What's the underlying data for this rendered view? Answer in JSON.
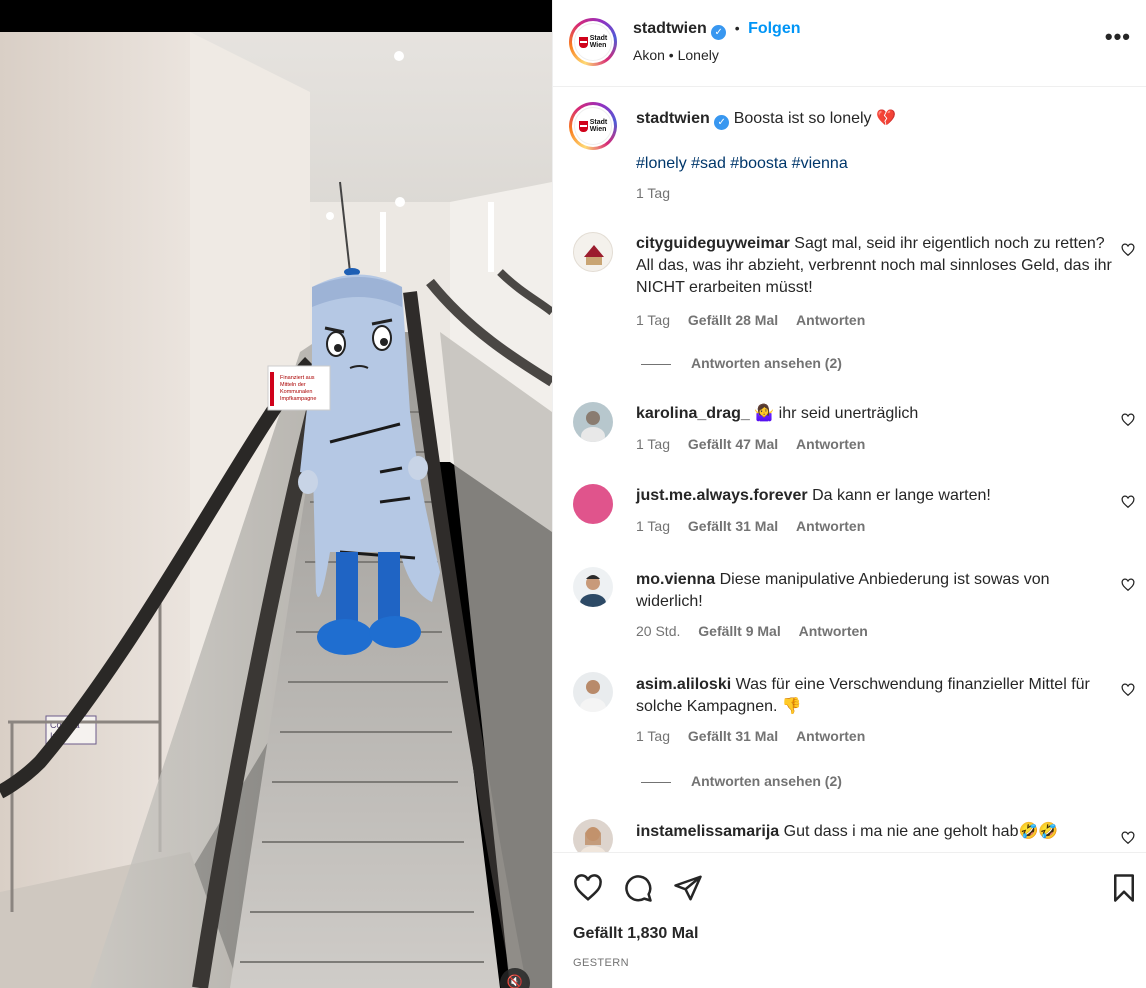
{
  "post": {
    "username": "stadtwien",
    "verified": true,
    "follow_label": "Folgen",
    "separator": "•",
    "audio": "Akon • Lonely",
    "more_icon": "more-horizontal-icon",
    "avatar_text": "Stadt Wien"
  },
  "caption": {
    "username": "stadtwien",
    "text": "Boosta ist so lonely 💔",
    "hashtags": "#lonely #sad #boosta #vienna",
    "time": "1 Tag"
  },
  "comments": [
    {
      "username": "cityguideguyweimar",
      "text": "Sagt mal, seid ihr eigentlich noch zu retten? All das, was ihr abzieht, verbrennt noch mal sinnloses Geld, das ihr NICHT erarbeiten müsst!",
      "time": "1 Tag",
      "likes": "Gefällt 28 Mal",
      "reply": "Antworten",
      "view_replies": "Antworten ansehen (2)"
    },
    {
      "username": "karolina_drag_",
      "text": "🤷‍♀️ ihr seid unerträglich",
      "time": "1 Tag",
      "likes": "Gefällt 47 Mal",
      "reply": "Antworten"
    },
    {
      "username": "just.me.always.forever",
      "text": "Da kann er lange warten!",
      "time": "1 Tag",
      "likes": "Gefällt 31 Mal",
      "reply": "Antworten"
    },
    {
      "username": "mo.vienna",
      "text": "Diese manipulative Anbiederung ist sowas von widerlich!",
      "time": "20 Std.",
      "likes": "Gefällt 9 Mal",
      "reply": "Antworten"
    },
    {
      "username": "asim.aliloski",
      "text": "Was für eine Verschwendung finanzieller Mittel für solche Kampagnen. 👎",
      "time": "1 Tag",
      "likes": "Gefällt 31 Mal",
      "reply": "Antworten",
      "view_replies": "Antworten ansehen (2)"
    },
    {
      "username": "instamelissamarija",
      "text": "Gut dass i ma nie ane geholt hab🤣🤣"
    }
  ],
  "actions": {
    "like_icon": "heart-icon",
    "comment_icon": "comment-icon",
    "share_icon": "share-icon",
    "save_icon": "bookmark-icon",
    "likes": "Gefällt 1,830 Mal",
    "date": "GESTERN"
  },
  "media": {
    "sign_text": "Finanziert aus Mitteln der Kommunalen Impfkampagne",
    "wall_sign": "Corona Impf",
    "mute_icon": "muted-speaker-icon"
  },
  "colors": {
    "link_blue": "#0095f6",
    "hashtag": "#00376b",
    "secondary": "#737373",
    "verified": "#3897f0"
  }
}
